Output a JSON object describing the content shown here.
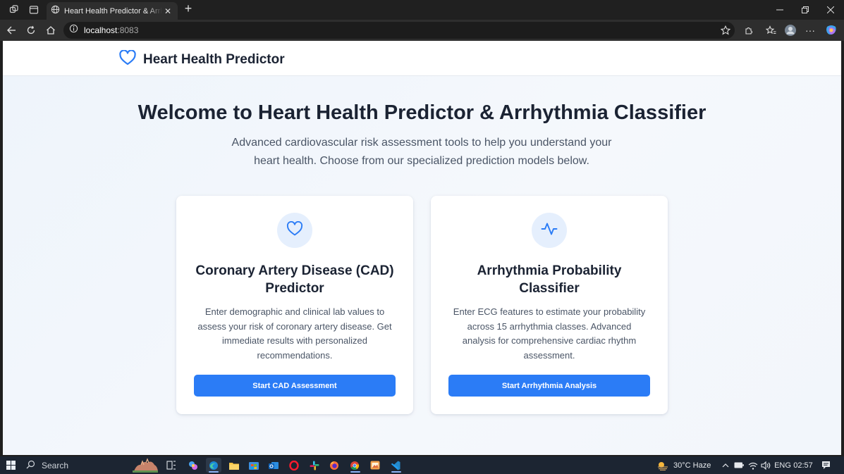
{
  "browser": {
    "tab_title": "Heart Health Predictor & Arrhythmia Classifier",
    "url_host": "localhost",
    "url_port": ":8083"
  },
  "header": {
    "brand_name": "Heart Health Predictor"
  },
  "hero": {
    "title": "Welcome to Heart Health Predictor & Arrhythmia Classifier",
    "subtitle_line1": "Advanced cardiovascular risk assessment tools to help you understand your",
    "subtitle_line2": "heart health. Choose from our specialized prediction models below."
  },
  "cards": [
    {
      "icon": "heart-icon",
      "title_line1": "Coronary Artery Disease (CAD)",
      "title_line2": "Predictor",
      "desc_lines": [
        "Enter demographic and clinical lab values to",
        "assess your risk of coronary artery disease. Get",
        "immediate results with personalized",
        "recommendations."
      ],
      "button_label": "Start CAD Assessment"
    },
    {
      "icon": "activity-icon",
      "title_line1": "Arrhythmia Probability",
      "title_line2": "Classifier",
      "desc_lines": [
        "Enter ECG features to estimate your probability",
        "across 15 arrhythmia classes. Advanced",
        "analysis for comprehensive cardiac rhythm",
        "assessment."
      ],
      "button_label": "Start Arrhythmia Analysis"
    }
  ],
  "taskbar": {
    "search_label": "Search",
    "weather": "30°C  Haze",
    "language": "ENG",
    "time": "02:57"
  },
  "colors": {
    "accent": "#2b7cf6",
    "icon_bg": "#e5effd",
    "text_dark": "#1b2333",
    "text_muted": "#4a5566"
  }
}
